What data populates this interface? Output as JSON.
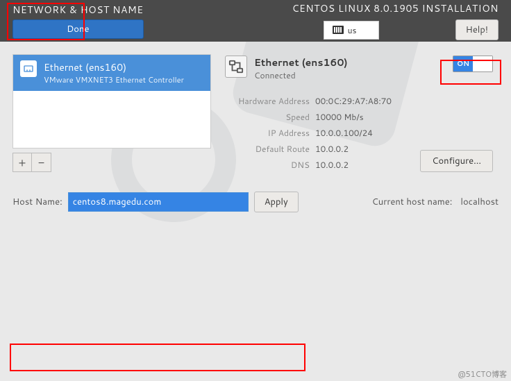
{
  "header": {
    "page_title": "NETWORK & HOST NAME",
    "done_label": "Done",
    "install_title": "CENTOS LINUX 8.0.1905 INSTALLATION",
    "keyboard_layout": "us",
    "help_label": "Help!"
  },
  "left": {
    "devices": [
      {
        "name": "Ethernet (ens160)",
        "desc": "VMware VMXNET3 Ethernet Controller"
      }
    ],
    "add_label": "+",
    "remove_label": "−"
  },
  "right": {
    "conn_name": "Ethernet (ens160)",
    "conn_status": "Connected",
    "toggle_label": "ON",
    "details": [
      {
        "label": "Hardware Address",
        "value": "00:0C:29:A7:A8:70"
      },
      {
        "label": "Speed",
        "value": "10000 Mb/s"
      },
      {
        "label": "IP Address",
        "value": "10.0.0.100/24"
      },
      {
        "label": "Default Route",
        "value": "10.0.0.2"
      },
      {
        "label": "DNS",
        "value": "10.0.0.2"
      }
    ],
    "configure_label": "Configure..."
  },
  "hostname": {
    "label": "Host Name:",
    "value": "centos8.magedu.com",
    "apply_label": "Apply",
    "current_label": "Current host name:",
    "current_value": "localhost"
  },
  "credit": "@51CTO博客"
}
